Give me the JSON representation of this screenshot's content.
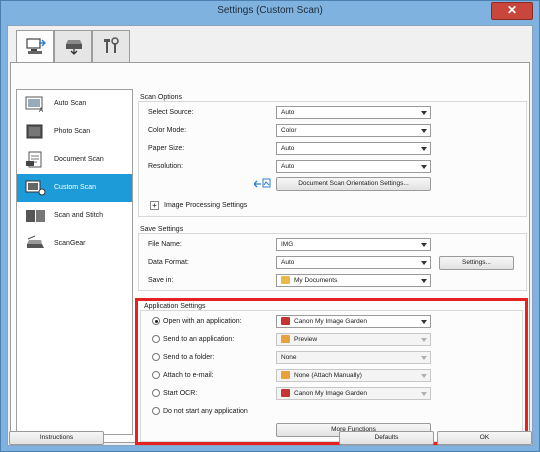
{
  "window": {
    "title": "Settings (Custom Scan)",
    "close_glyph": "✕"
  },
  "tabs": [
    {
      "name": "scan-from-computer",
      "icon": "computer-scan-icon"
    },
    {
      "name": "scan-from-panel",
      "icon": "scanner-icon"
    },
    {
      "name": "general-settings",
      "icon": "tools-icon"
    }
  ],
  "sidebar": {
    "items": [
      {
        "label": "Auto Scan",
        "icon": "auto-scan-icon"
      },
      {
        "label": "Photo Scan",
        "icon": "photo-scan-icon"
      },
      {
        "label": "Document Scan",
        "icon": "document-scan-icon"
      },
      {
        "label": "Custom Scan",
        "icon": "custom-scan-icon",
        "selected": true
      },
      {
        "label": "Scan and Stitch",
        "icon": "scan-stitch-icon"
      },
      {
        "label": "ScanGear",
        "icon": "scangear-icon"
      }
    ]
  },
  "scan_options": {
    "title": "Scan Options",
    "select_source": {
      "label": "Select Source:",
      "value": "Auto"
    },
    "color_mode": {
      "label": "Color Mode:",
      "value": "Color"
    },
    "paper_size": {
      "label": "Paper Size:",
      "value": "Auto"
    },
    "resolution": {
      "label": "Resolution:",
      "value": "Auto"
    },
    "orientation_button": "Document Scan Orientation Settings...",
    "image_processing": {
      "expander": "+",
      "label": "Image Processing Settings"
    }
  },
  "save_settings": {
    "title": "Save Settings",
    "file_name": {
      "label": "File Name:",
      "value": "IMG"
    },
    "data_format": {
      "label": "Data Format:",
      "value": "Auto"
    },
    "settings_button": "Settings...",
    "save_in": {
      "label": "Save in:",
      "value": "My Documents"
    }
  },
  "application_settings": {
    "title": "Application Settings",
    "options": [
      {
        "label": "Open with an application:",
        "value": "Canon My Image Garden",
        "selected": true,
        "enabled": true
      },
      {
        "label": "Send to an application:",
        "value": "Preview",
        "selected": false,
        "enabled": false
      },
      {
        "label": "Send to a folder:",
        "value": "None",
        "selected": false,
        "enabled": false
      },
      {
        "label": "Attach to e-mail:",
        "value": "None (Attach Manually)",
        "selected": false,
        "enabled": false
      },
      {
        "label": "Start OCR:",
        "value": "Canon My Image Garden",
        "selected": false,
        "enabled": false
      },
      {
        "label": "Do not start any application",
        "selected": false
      }
    ],
    "more_functions_button": "More Functions",
    "highlight_color": "#e52222"
  },
  "footer": {
    "instructions_button": "Instructions",
    "defaults_button": "Defaults",
    "ok_button": "OK"
  },
  "colors": {
    "accent": "#1d9bd9",
    "window_frame": "#7fb2de"
  }
}
